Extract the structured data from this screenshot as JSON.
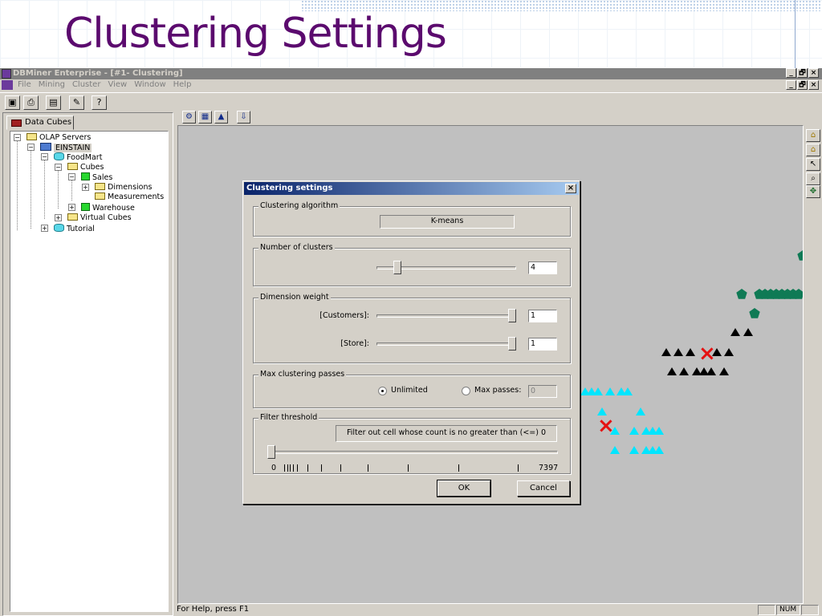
{
  "slide": {
    "title": "Clustering Settings"
  },
  "window": {
    "title": "DBMiner Enterprise - [#1- Clustering]",
    "controls": {
      "minimize": "_",
      "restore": "🗗",
      "close": "×"
    }
  },
  "menu": {
    "items": [
      "File",
      "Mining",
      "Cluster",
      "View",
      "Window",
      "Help"
    ]
  },
  "toolbar": {
    "buttons": [
      {
        "icon": "save-icon",
        "glyph": "▣"
      },
      {
        "icon": "print-icon",
        "glyph": "⎙"
      },
      {
        "icon": "properties-icon",
        "glyph": "▤"
      },
      {
        "icon": "wand-icon",
        "glyph": "✎"
      },
      {
        "icon": "help-icon",
        "glyph": "?"
      }
    ]
  },
  "left_pane": {
    "tab_label": "Data Cubes",
    "tree": [
      {
        "label": "OLAP Servers",
        "icon": "folder-icon",
        "expander": "−"
      },
      {
        "label": "EINSTAIN",
        "icon": "server-icon",
        "expander": "−"
      },
      {
        "label": "FoodMart",
        "icon": "database-icon",
        "expander": "−"
      },
      {
        "label": "Cubes",
        "icon": "folder-icon",
        "expander": "−"
      },
      {
        "label": "Sales",
        "icon": "cube-icon",
        "expander": "−"
      },
      {
        "label": "Dimensions",
        "icon": "folder-icon",
        "expander": "+"
      },
      {
        "label": "Measurements",
        "icon": "folder-icon",
        "expander": ""
      },
      {
        "label": "Warehouse",
        "icon": "cube-icon",
        "expander": "+"
      },
      {
        "label": "Virtual Cubes",
        "icon": "folder-icon",
        "expander": "+"
      },
      {
        "label": "Tutorial",
        "icon": "database-icon",
        "expander": "+"
      }
    ]
  },
  "view_toolbar": {
    "buttons": [
      {
        "icon": "settings-icon",
        "glyph": "⚙"
      },
      {
        "icon": "grid-icon",
        "glyph": "▦"
      },
      {
        "icon": "chart-icon",
        "glyph": "▲"
      },
      {
        "icon": "export-icon",
        "glyph": "⇩"
      }
    ]
  },
  "side_tools": {
    "buttons": [
      {
        "icon": "home-icon",
        "glyph": "⌂"
      },
      {
        "icon": "home-alt-icon",
        "glyph": "⌂"
      },
      {
        "icon": "pointer-icon",
        "glyph": "↖"
      },
      {
        "icon": "zoom-icon",
        "glyph": "⌕"
      },
      {
        "icon": "move-icon",
        "glyph": "✥"
      }
    ]
  },
  "colors": {
    "title": "#5b0a6e",
    "teal_cluster": "#00e5ff",
    "green_cluster": "#0f7a55",
    "black_cluster": "#000000",
    "centroid": "#e51111"
  },
  "dialog": {
    "title": "Clustering settings",
    "close": "×",
    "algorithm": {
      "label": "Clustering algorithm",
      "value": "K-means"
    },
    "clusters": {
      "label": "Number of clusters",
      "value": "4",
      "slider_level": 0.13
    },
    "weights": {
      "label": "Dimension weight",
      "items": [
        {
          "name": "[Customers]:",
          "value": "1",
          "slider_level": 1.0
        },
        {
          "name": "[Store]:",
          "value": "1",
          "slider_level": 1.0
        }
      ]
    },
    "passes": {
      "label": "Max clustering passes",
      "unlimited_label": "Unlimited",
      "max_label": "Max passes:",
      "max_value": "0",
      "selected": "unlimited"
    },
    "filter": {
      "label": "Filter threshold",
      "text": "Filter out cell whose count is no greater than (<=) 0",
      "min": "0",
      "max": "7397",
      "slider_level": 0.0
    },
    "ok_label": "OK",
    "cancel_label": "Cancel"
  },
  "status": {
    "help": "For Help, press F1",
    "num": "NUM"
  }
}
